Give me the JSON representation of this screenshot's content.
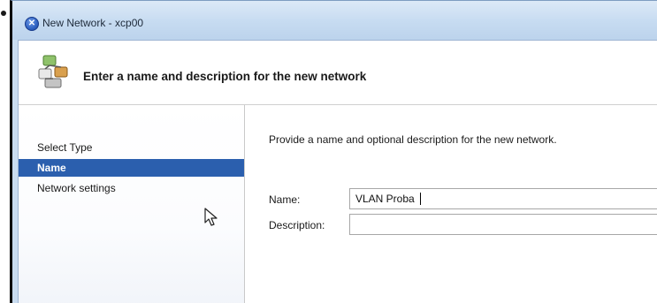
{
  "window": {
    "title": "New Network - xcp00"
  },
  "wizard": {
    "header": "Enter a name and description for the new network",
    "header_icon": "network-wizard-icon"
  },
  "sidebar": {
    "items": [
      {
        "label": "Select Type",
        "active": false
      },
      {
        "label": "Name",
        "active": true
      },
      {
        "label": "Network settings",
        "active": false
      }
    ]
  },
  "form": {
    "instruction": "Provide a name and optional description for the new network.",
    "name_label": "Name:",
    "name_value": "VLAN Proba",
    "description_label": "Description:",
    "description_value": ""
  },
  "colors": {
    "titlebar": "#c9dcf0",
    "selection": "#2b5fae"
  }
}
